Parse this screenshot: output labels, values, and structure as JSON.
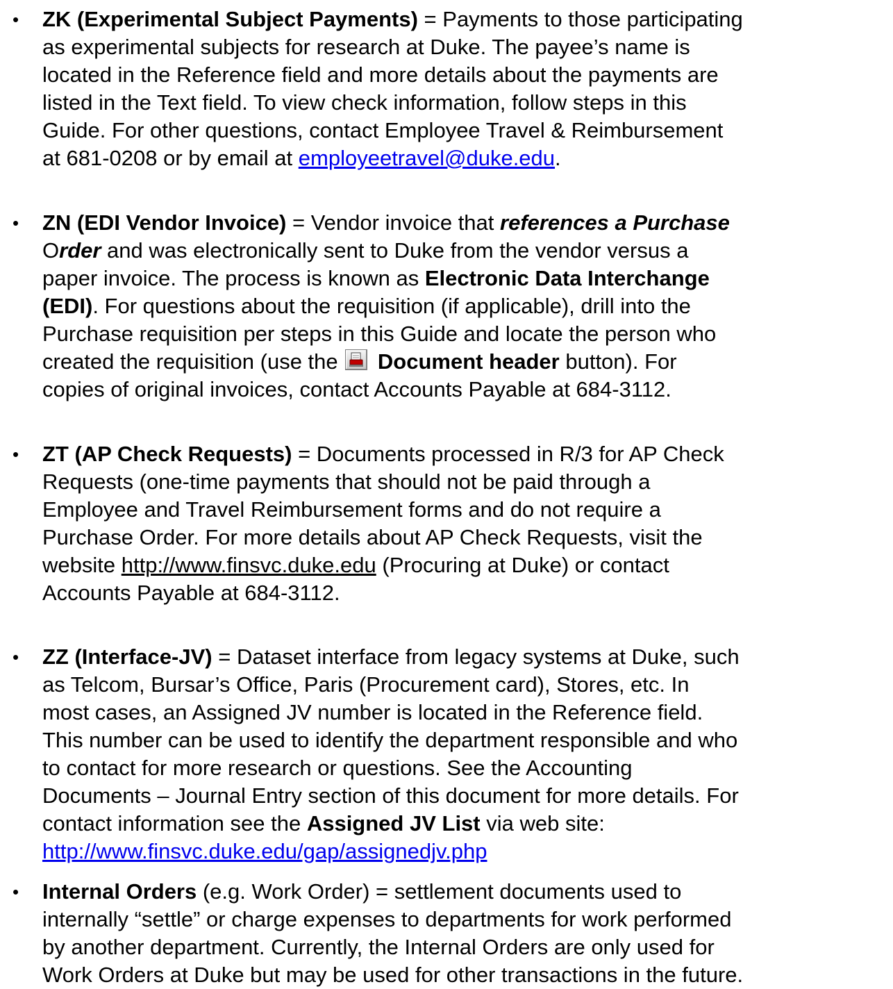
{
  "items": [
    {
      "term": "ZK (Experimental Subject Payments)",
      "lines": [
        " = Payments to those participating",
        "as experimental subjects for research at Duke.  The payee’s name is",
        "located in the Reference field and more details about the payments are",
        "listed in the Text field.  To view check information, follow steps in this",
        "Guide.  For other questions, contact Employee Travel & Reimbursement",
        "at 681-0208 or by email at "
      ],
      "email": "employeetravel@duke.edu",
      "email_after": "."
    },
    {
      "term": "ZN (EDI Vendor Invoice)",
      "line1_text": " = Vendor invoice that ",
      "line1_bi": "references a Purchase",
      "line2_o": "O",
      "line2_bi": "rder",
      "line2_text": " and was electronically sent to Duke from the vendor versus a",
      "line3_text": "paper invoice.  The process is known as ",
      "line3_bold": "Electronic Data Interchange",
      "line4_bold": "(EDI)",
      "line4_text": ".  For questions about the requisition (if applicable), drill into the",
      "line5": "Purchase requisition per steps in this Guide and locate the person who",
      "line6_text": "created the requisition (use the ",
      "line6_bold": "Document header",
      "line6_after": " button).  For",
      "line7": "copies of original invoices, contact Accounts Payable at 684-3112.",
      "icon": "document-header-icon"
    },
    {
      "term": "ZT (AP Check Requests)",
      "lines": [
        " = Documents processed in R/3 for AP Check",
        "Requests (one-time payments that should not be paid through a",
        "Employee and Travel Reimbursement forms and do not require a",
        "Purchase Order.  For more details about AP Check Requests, visit the"
      ],
      "line5_before": "website ",
      "url": "http://www.finsvc.duke.edu",
      "line5_after": " (Procuring at Duke) or contact",
      "line6": "Accounts Payable at 684-3112."
    },
    {
      "term": "ZZ (Interface-JV)",
      "lines": [
        " = Dataset interface from legacy systems at Duke, such",
        "as Telcom, Bursar’s Office, Paris (Procurement card), Stores, etc.  In",
        "most cases, an Assigned JV number is located in the Reference field.",
        "This number can be used to identify the department responsible and who",
        "to contact for more research or questions.  See the Accounting",
        "Documents – Journal Entry section of this document for more details. For"
      ],
      "line7_text": "contact information see the ",
      "line7_bold": "Assigned JV List",
      "line7_after": " via web site:",
      "url": "http://www.finsvc.duke.edu/gap/assignedjv.php"
    },
    {
      "term": "Internal Orders",
      "lines": [
        " (e.g. Work Order) = settlement documents used to",
        "internally “settle” or charge expenses to departments for work performed",
        "by another department.  Currently, the Internal Orders are only used for",
        "Work Orders at Duke but may be used for other transactions in the future."
      ]
    }
  ],
  "bullet_symbol": "•"
}
